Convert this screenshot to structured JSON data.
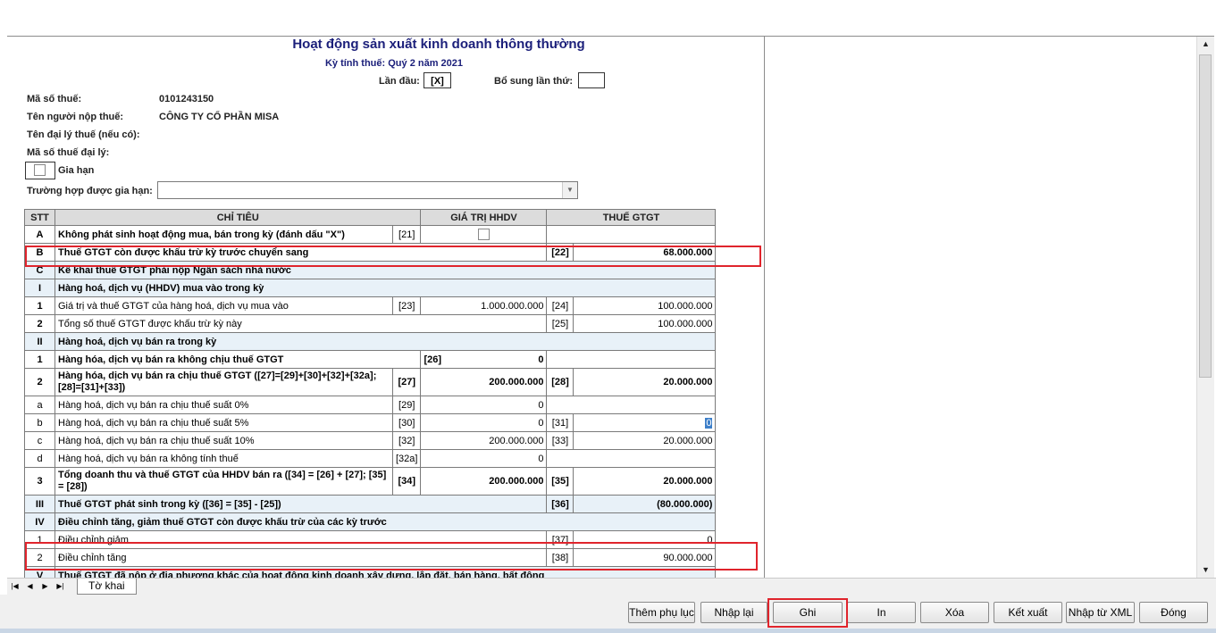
{
  "form": {
    "title": "Hoạt động sản xuất kinh doanh thông thường",
    "period": "Kỳ tính thuế: Quý 2 năm 2021",
    "first_label": "Lần đầu:",
    "first_value": "[X]",
    "supplement_label": "Bổ sung lần thứ:",
    "supplement_value": "",
    "tax_code_label": "Mã số thuế:",
    "tax_code": "0101243150",
    "taxpayer_label": "Tên người nộp thuế:",
    "taxpayer": "CÔNG TY CỔ PHẦN MISA",
    "agent_label": "Tên đại lý thuế (nếu có):",
    "agent_code_label": "Mã số thuế đại lý:",
    "extension_label": "Gia hạn",
    "extension_case_label": "Trường hợp được gia hạn:",
    "extension_case_value": ""
  },
  "table": {
    "headers": {
      "stt": "STT",
      "indicator": "CHỈ TIÊU",
      "value": "GIÁ TRỊ HHDV",
      "vat": "THUẾ GTGT"
    },
    "rows": [
      {
        "stt": "A",
        "text": "Không phát sinh hoạt động mua, bán trong kỳ (đánh dấu \"X\")",
        "code1": "[21]"
      },
      {
        "stt": "B",
        "text": "Thuế GTGT còn được khấu trừ kỳ trước chuyển sang",
        "code2": "[22]",
        "vat": "68.000.000"
      },
      {
        "stt": "C",
        "text": "Kê khai thuế GTGT phải nộp Ngân sách nhà nước"
      },
      {
        "stt": "I",
        "text": "Hàng hoá, dịch vụ (HHDV) mua vào trong kỳ"
      },
      {
        "stt": "1",
        "text": "Giá trị và thuế GTGT của hàng hoá, dịch vụ mua vào",
        "code1": "[23]",
        "value": "1.000.000.000",
        "code2": "[24]",
        "vat": "100.000.000"
      },
      {
        "stt": "2",
        "text": "Tổng số thuế GTGT được khấu trừ kỳ này",
        "code2": "[25]",
        "vat": "100.000.000"
      },
      {
        "stt": "II",
        "text": "Hàng hoá, dịch vụ bán ra trong kỳ"
      },
      {
        "stt": "1",
        "text": "Hàng hóa, dịch vụ bán ra không chịu thuế GTGT",
        "code1": "[26]",
        "value": "0"
      },
      {
        "stt": "2",
        "text": "Hàng hóa, dịch vụ bán ra chịu thuế GTGT ([27]=[29]+[30]+[32]+[32a]; [28]=[31]+[33])",
        "code1": "[27]",
        "value": "200.000.000",
        "code2": "[28]",
        "vat": "20.000.000"
      },
      {
        "stt": "a",
        "text": "Hàng hoá, dịch vụ bán ra chịu thuế suất 0%",
        "code1": "[29]",
        "value": "0"
      },
      {
        "stt": "b",
        "text": "Hàng hoá, dịch vụ bán ra chịu thuế suất 5%",
        "code1": "[30]",
        "value": "0",
        "code2": "[31]",
        "vat": "0"
      },
      {
        "stt": "c",
        "text": "Hàng hoá, dịch vụ bán ra chịu thuế suất 10%",
        "code1": "[32]",
        "value": "200.000.000",
        "code2": "[33]",
        "vat": "20.000.000"
      },
      {
        "stt": "d",
        "text": "Hàng hoá, dịch vụ bán ra không tính thuế",
        "code1": "[32a]",
        "value": "0"
      },
      {
        "stt": "3",
        "text": "Tổng doanh thu và thuế GTGT của HHDV bán ra ([34] = [26] + [27]; [35] = [28])",
        "code1": "[34]",
        "value": "200.000.000",
        "code2": "[35]",
        "vat": "20.000.000"
      },
      {
        "stt": "III",
        "text": "Thuế GTGT phát sinh trong kỳ ([36] = [35] - [25])",
        "code2": "[36]",
        "vat": "(80.000.000)"
      },
      {
        "stt": "IV",
        "text": "Điều chỉnh tăng, giảm thuế GTGT còn được khấu trừ của các kỳ trước"
      },
      {
        "stt": "1",
        "text": "Điều chỉnh giảm",
        "code2": "[37]",
        "vat": "0"
      },
      {
        "stt": "2",
        "text": "Điều chỉnh tăng",
        "code2": "[38]",
        "vat": "90.000.000"
      },
      {
        "stt": "V",
        "text": "Thuế GTGT đã nộp ở địa phương khác của hoạt động kinh doanh xây dựng, lắp đặt, bán hàng, bất động"
      }
    ]
  },
  "tabs": {
    "sheet": "Tờ khai"
  },
  "buttons": {
    "add_appendix": "Thêm phụ lục",
    "reenter": "Nhập lại",
    "save": "Ghi",
    "print": "In",
    "delete": "Xóa",
    "export": "Kết xuất",
    "import_xml": "Nhập từ XML",
    "close": "Đóng"
  },
  "colors": {
    "highlight": "#e0242c",
    "title": "#1b1f7a",
    "section_bg": "#e8f1f8",
    "header_bg": "#dcdcdc"
  }
}
